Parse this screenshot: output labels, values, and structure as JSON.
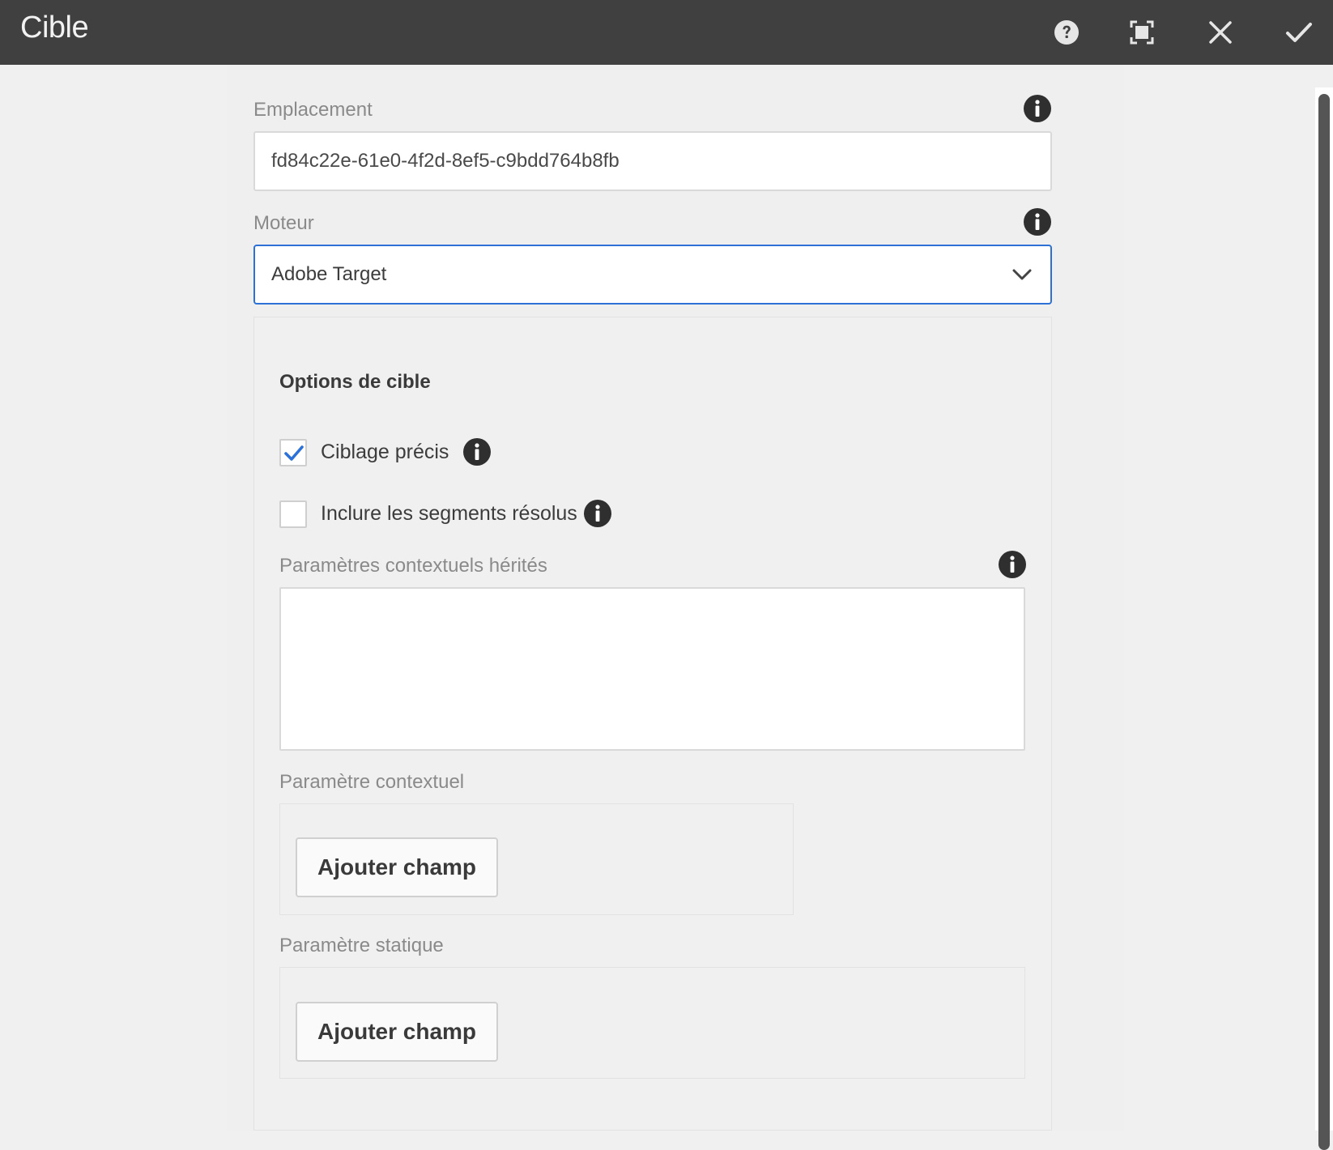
{
  "dialog": {
    "title": "Cible",
    "actions": [
      {
        "name": "help",
        "icon": "help-circle-icon"
      },
      {
        "name": "fullscreen",
        "icon": "fullscreen-icon"
      },
      {
        "name": "cancel",
        "icon": "close-icon"
      },
      {
        "name": "done",
        "icon": "checkmark-icon"
      }
    ]
  },
  "location": {
    "label": "Emplacement",
    "value": "fd84c22e-61e0-4f2d-8ef5-c9bdd764b8fb"
  },
  "engine": {
    "label": "Moteur",
    "selected": "Adobe Target"
  },
  "target_options": {
    "title": "Options de cible",
    "accurate_targeting": {
      "label": "Ciblage précis",
      "checked": true
    },
    "include_resolved_segments": {
      "label": "Inclure les segments résolus",
      "checked": false
    },
    "inherited_context_params": {
      "label": "Paramètres contextuels hérités",
      "value": ""
    },
    "context_param": {
      "label": "Paramètre contextuel",
      "add_button": "Ajouter champ"
    },
    "static_param": {
      "label": "Paramètre statique",
      "add_button": "Ajouter champ"
    }
  },
  "colors": {
    "titlebar": "#404040",
    "accent": "#2d71d6",
    "background": "#f0f0f0"
  }
}
